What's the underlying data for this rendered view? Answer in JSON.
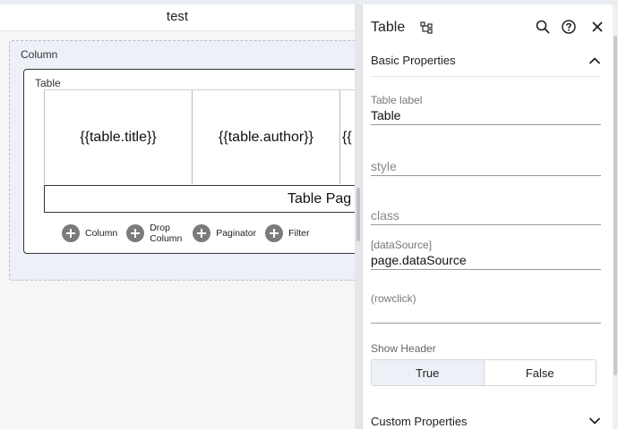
{
  "canvas": {
    "page_title": "test",
    "column_label": "Column",
    "table_label": "Table",
    "cells": [
      "{{table.title}}",
      "{{table.author}}",
      "{{"
    ],
    "paginator_text": "Table Pag",
    "actions": [
      {
        "label": "Column",
        "icon": "plus-circle-icon"
      },
      {
        "label_line1": "Drop",
        "label_line2": "Column",
        "icon": "plus-circle-icon"
      },
      {
        "label": "Paginator",
        "icon": "plus-circle-icon"
      },
      {
        "label": "Filter",
        "icon": "plus-circle-icon"
      }
    ]
  },
  "panel": {
    "title": "Table",
    "icons": [
      "tree-icon",
      "search-icon",
      "help-icon",
      "close-icon"
    ],
    "basic_properties": "Basic Properties",
    "fields": {
      "table_label": {
        "label": "Table label",
        "value": "Table"
      },
      "style": {
        "placeholder": "style"
      },
      "class": {
        "placeholder": "class"
      },
      "data_source": {
        "label": "[dataSource]",
        "value": "page.dataSource"
      },
      "rowclick": {
        "label": "(rowclick)",
        "value": ""
      }
    },
    "show_header": {
      "label": "Show Header",
      "options": [
        "True",
        "False"
      ],
      "selected": "True"
    },
    "custom_properties": "Custom Properties"
  },
  "colors": {
    "selection_bg": "#eef0f8",
    "icon_gray": "#7b7b7b"
  }
}
